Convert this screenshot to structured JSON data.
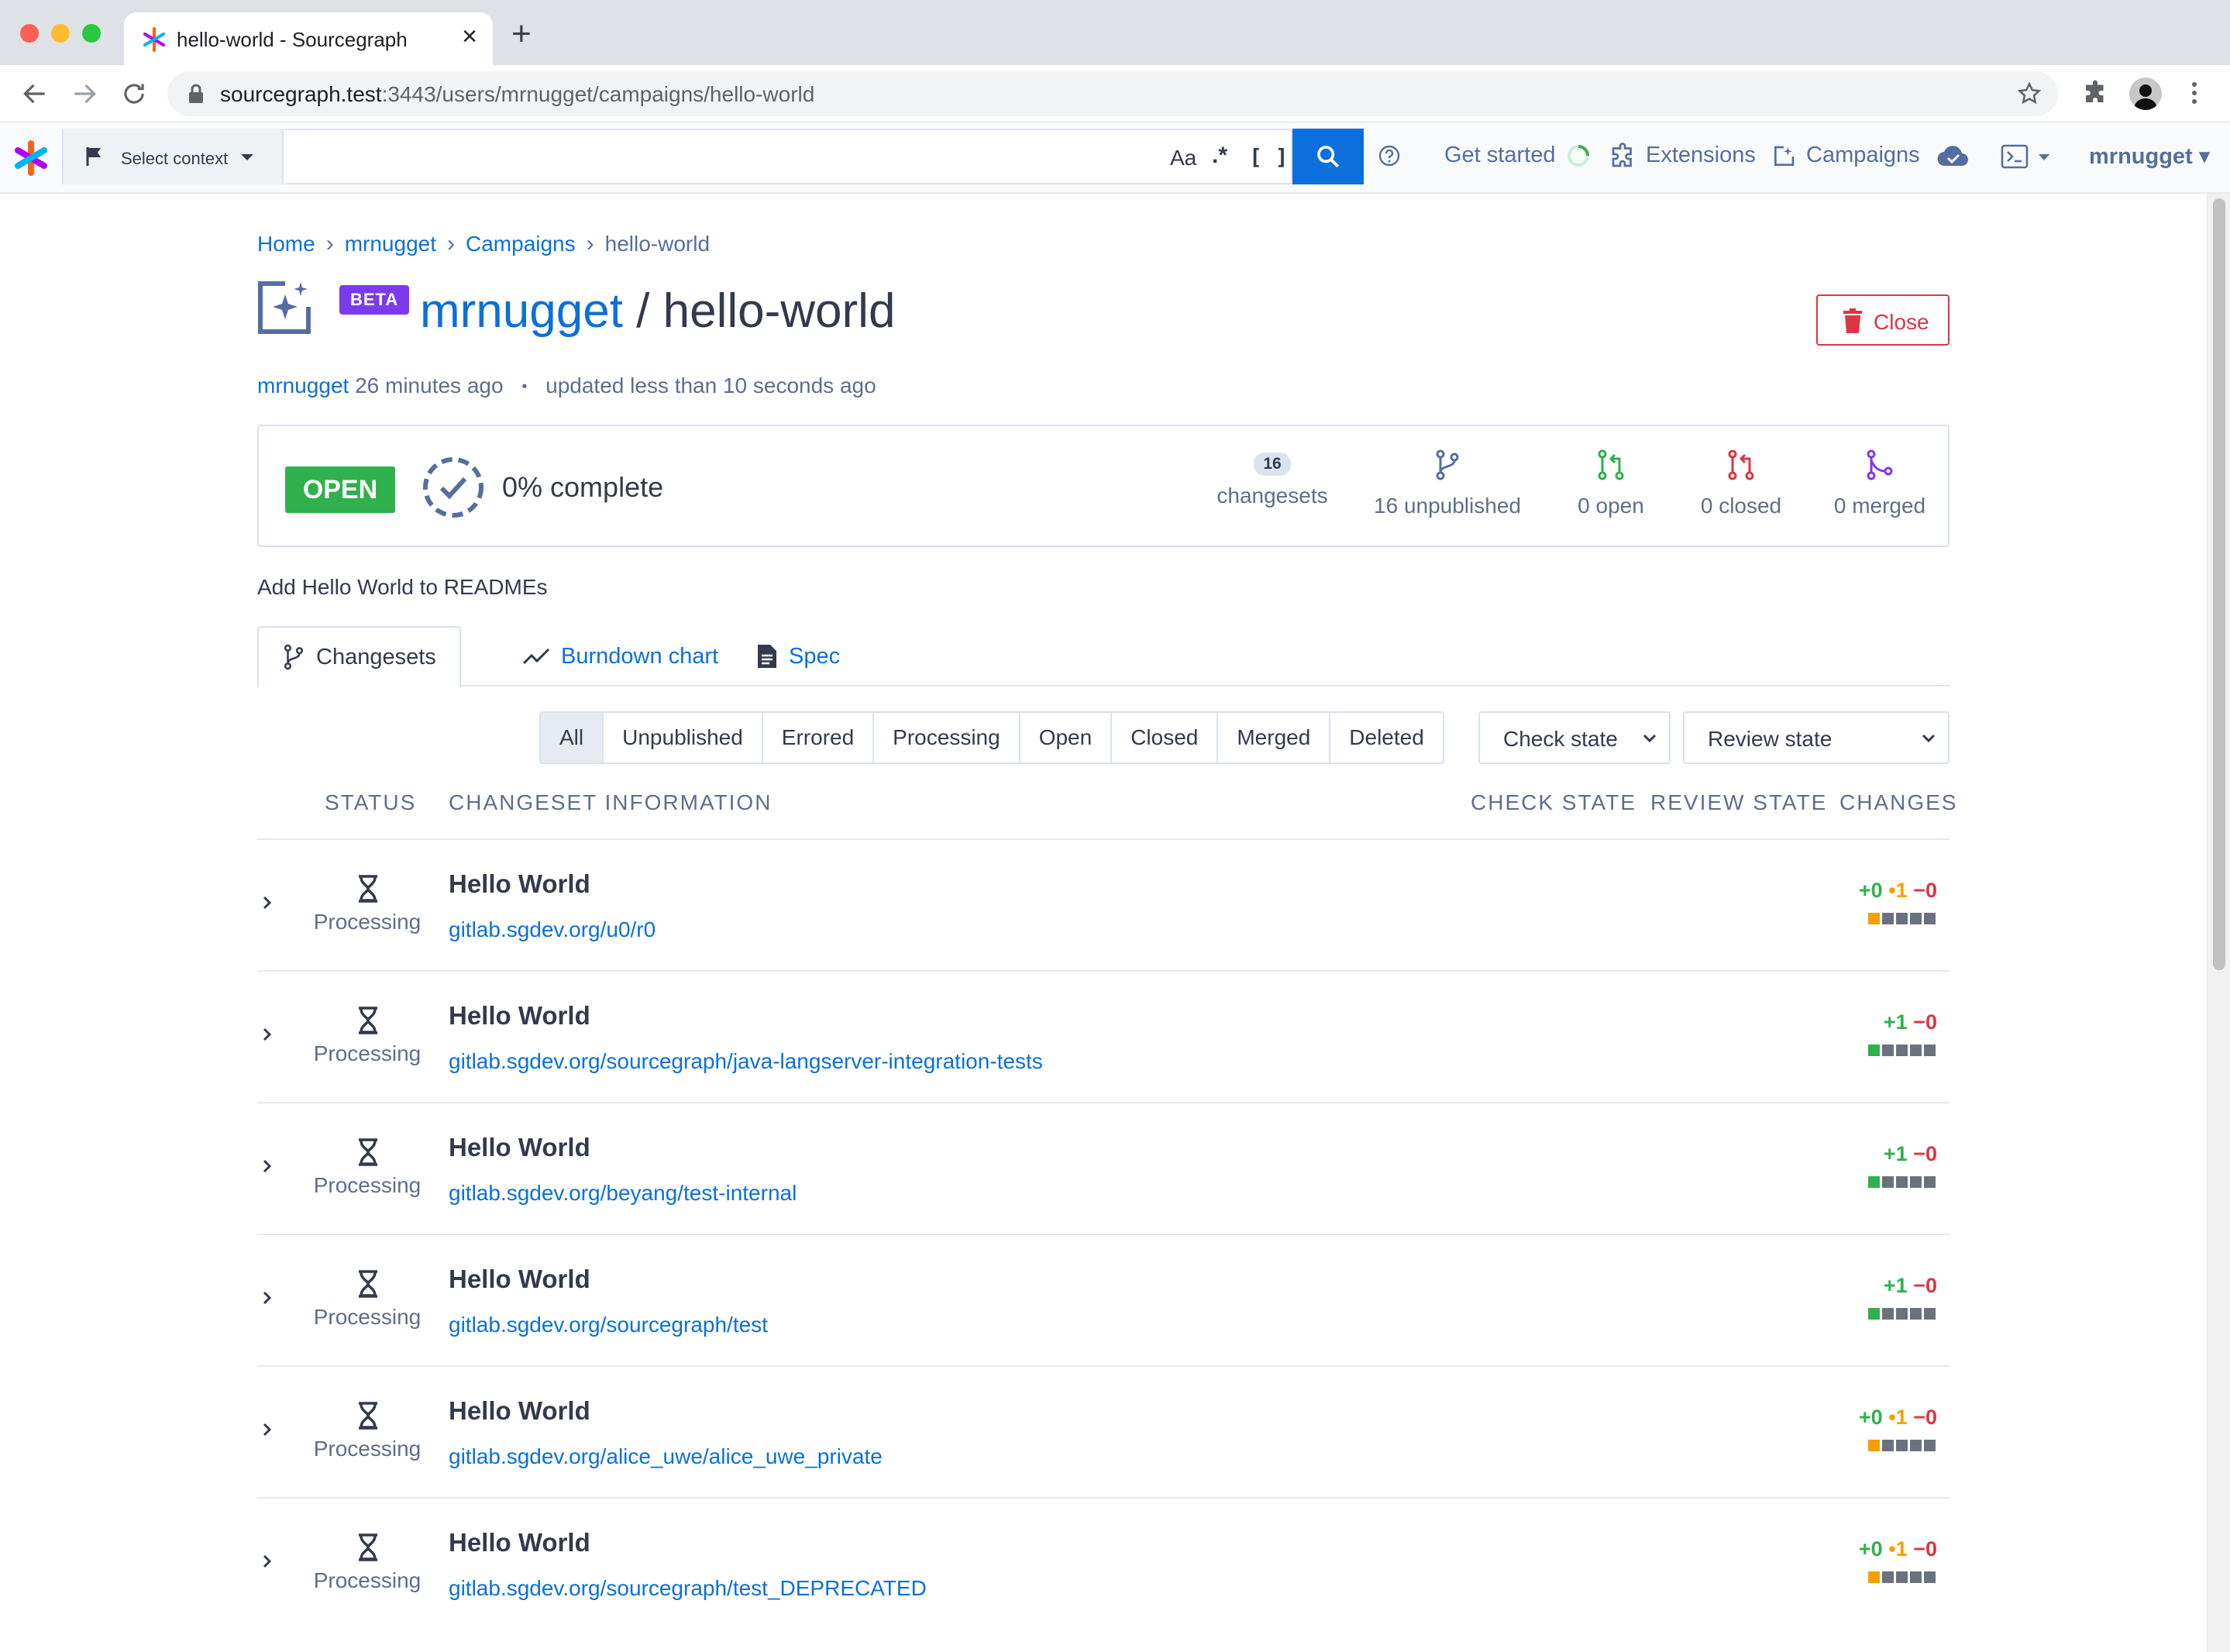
{
  "browser": {
    "tab_title": "hello-world - Sourcegraph",
    "url_host": "sourcegraph.test",
    "url_rest": ":3443/users/mrnugget/campaigns/hello-world"
  },
  "nav": {
    "context_label": "Select context",
    "case_toggle": "Aa",
    "regex_toggle": ".*",
    "structural_toggle": "[ ]",
    "get_started": "Get started",
    "extensions": "Extensions",
    "campaigns": "Campaigns",
    "user": "mrnugget"
  },
  "breadcrumb": [
    "Home",
    "mrnugget",
    "Campaigns",
    "hello-world"
  ],
  "header": {
    "beta": "BETA",
    "namespace": "mrnugget",
    "separator": " / ",
    "name": "hello-world",
    "close_label": "Close",
    "author": "mrnugget",
    "created": " 26 minutes ago",
    "bullet": "•",
    "updated": "updated less than 10 seconds ago"
  },
  "stats": {
    "state": "OPEN",
    "percent_complete": "0% complete",
    "changesets_count": "16",
    "changesets_label": "changesets",
    "unpublished": "16 unpublished",
    "open": "0 open",
    "closed": "0 closed",
    "merged": "0 merged"
  },
  "description": "Add Hello World to READMEs",
  "tabs": [
    "Changesets",
    "Burndown chart",
    "Spec"
  ],
  "filters": [
    "All",
    "Unpublished",
    "Errored",
    "Processing",
    "Open",
    "Closed",
    "Merged",
    "Deleted"
  ],
  "check_state_select": "Check state",
  "review_state_select": "Review state",
  "columns": {
    "status": "STATUS",
    "info": "CHANGESET INFORMATION",
    "check": "CHECK STATE",
    "review": "REVIEW STATE",
    "changes": "CHANGES"
  },
  "colors": {
    "accent": "#0b70db",
    "open_green": "#2fb14d",
    "closed_red": "#dc3545",
    "merged_purple": "#7c3aed",
    "changed_orange": "#f59f00"
  },
  "changesets": [
    {
      "status": "Processing",
      "title": "Hello World",
      "repo": "gitlab.sgdev.org/u0/r0",
      "added": "+0",
      "changed": "•1",
      "deleted": "−0",
      "diff_blocks": [
        "changed",
        "neutral",
        "neutral",
        "neutral",
        "neutral"
      ]
    },
    {
      "status": "Processing",
      "title": "Hello World",
      "repo": "gitlab.sgdev.org/sourcegraph/java-langserver-integration-tests",
      "added": "+1",
      "changed": "",
      "deleted": "−0",
      "diff_blocks": [
        "added",
        "neutral",
        "neutral",
        "neutral",
        "neutral"
      ]
    },
    {
      "status": "Processing",
      "title": "Hello World",
      "repo": "gitlab.sgdev.org/beyang/test-internal",
      "added": "+1",
      "changed": "",
      "deleted": "−0",
      "diff_blocks": [
        "added",
        "neutral",
        "neutral",
        "neutral",
        "neutral"
      ]
    },
    {
      "status": "Processing",
      "title": "Hello World",
      "repo": "gitlab.sgdev.org/sourcegraph/test",
      "added": "+1",
      "changed": "",
      "deleted": "−0",
      "diff_blocks": [
        "added",
        "neutral",
        "neutral",
        "neutral",
        "neutral"
      ]
    },
    {
      "status": "Processing",
      "title": "Hello World",
      "repo": "gitlab.sgdev.org/alice_uwe/alice_uwe_private",
      "added": "+0",
      "changed": "•1",
      "deleted": "−0",
      "diff_blocks": [
        "changed",
        "neutral",
        "neutral",
        "neutral",
        "neutral"
      ]
    },
    {
      "status": "Processing",
      "title": "Hello World",
      "repo": "gitlab.sgdev.org/sourcegraph/test_DEPRECATED",
      "added": "+0",
      "changed": "•1",
      "deleted": "−0",
      "diff_blocks": [
        "changed",
        "neutral",
        "neutral",
        "neutral",
        "neutral"
      ]
    }
  ]
}
